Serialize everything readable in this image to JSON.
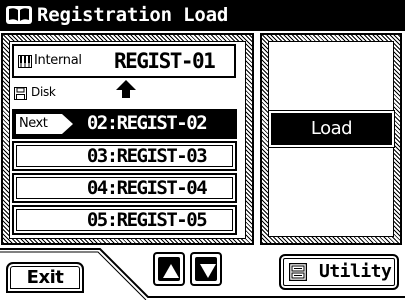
{
  "window": {
    "title": "Registration Load",
    "title_icon": "book-icon"
  },
  "internal": {
    "icon": "keyboard-icon",
    "label": "Internal",
    "value": "REGIST-01"
  },
  "disk": {
    "icon": "floppy-disk-icon",
    "label": "Disk"
  },
  "list": {
    "next_label": "Next",
    "items": [
      {
        "label": "02:REGIST-02",
        "selected": true
      },
      {
        "label": "03:REGIST-03",
        "selected": false
      },
      {
        "label": "04:REGIST-04",
        "selected": false
      },
      {
        "label": "05:REGIST-05",
        "selected": false
      }
    ]
  },
  "buttons": {
    "load": "Load",
    "exit": "Exit",
    "utility": "Utility",
    "scroll_up_icon": "up-arrow-icon",
    "scroll_down_icon": "down-arrow-icon"
  },
  "colors": {
    "foreground": "#000000",
    "background": "#ffffff"
  }
}
